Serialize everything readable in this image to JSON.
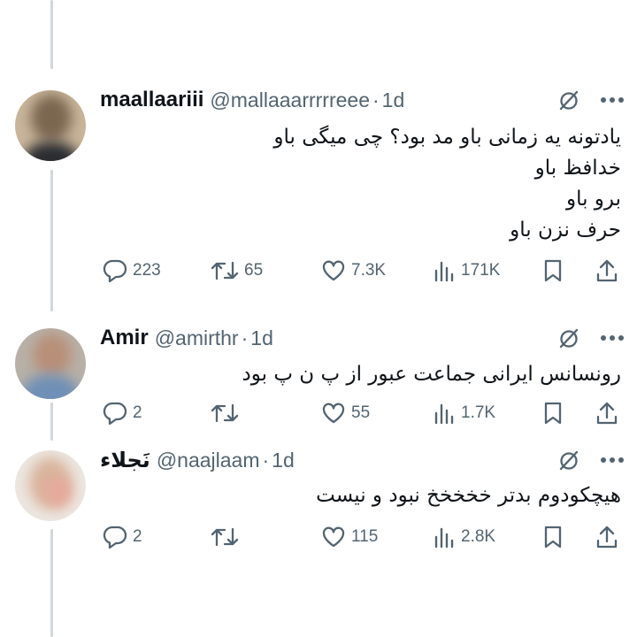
{
  "tweets": [
    {
      "name": "maallaariii",
      "handle": "@mallaaarrrrreee",
      "time": "1d",
      "lines": [
        "یادتونه یه زمانی باو مد بود؟ چی میگی باو",
        "خدافظ باو",
        "برو باو",
        "حرف نزن باو"
      ],
      "replies": "223",
      "retweets": "65",
      "likes": "7.3K",
      "views": "171K"
    },
    {
      "name": "Amir",
      "handle": "@amirthr",
      "time": "1d",
      "lines": [
        "رونسانس ایرانی جماعت عبور از پ ن پ بود"
      ],
      "replies": "2",
      "retweets": "",
      "likes": "55",
      "views": "1.7K"
    },
    {
      "name": "نَجلاء",
      "handle": "@naajlaam",
      "time": "1d",
      "lines": [
        "هیچکودوم بدتر خخخخخ نبود و نیست"
      ],
      "replies": "2",
      "retweets": "",
      "likes": "115",
      "views": "2.8K"
    }
  ],
  "separator": "·",
  "colors": {
    "text": "#0f1419",
    "secondary": "#536471",
    "thread_line": "#d2d7db"
  }
}
